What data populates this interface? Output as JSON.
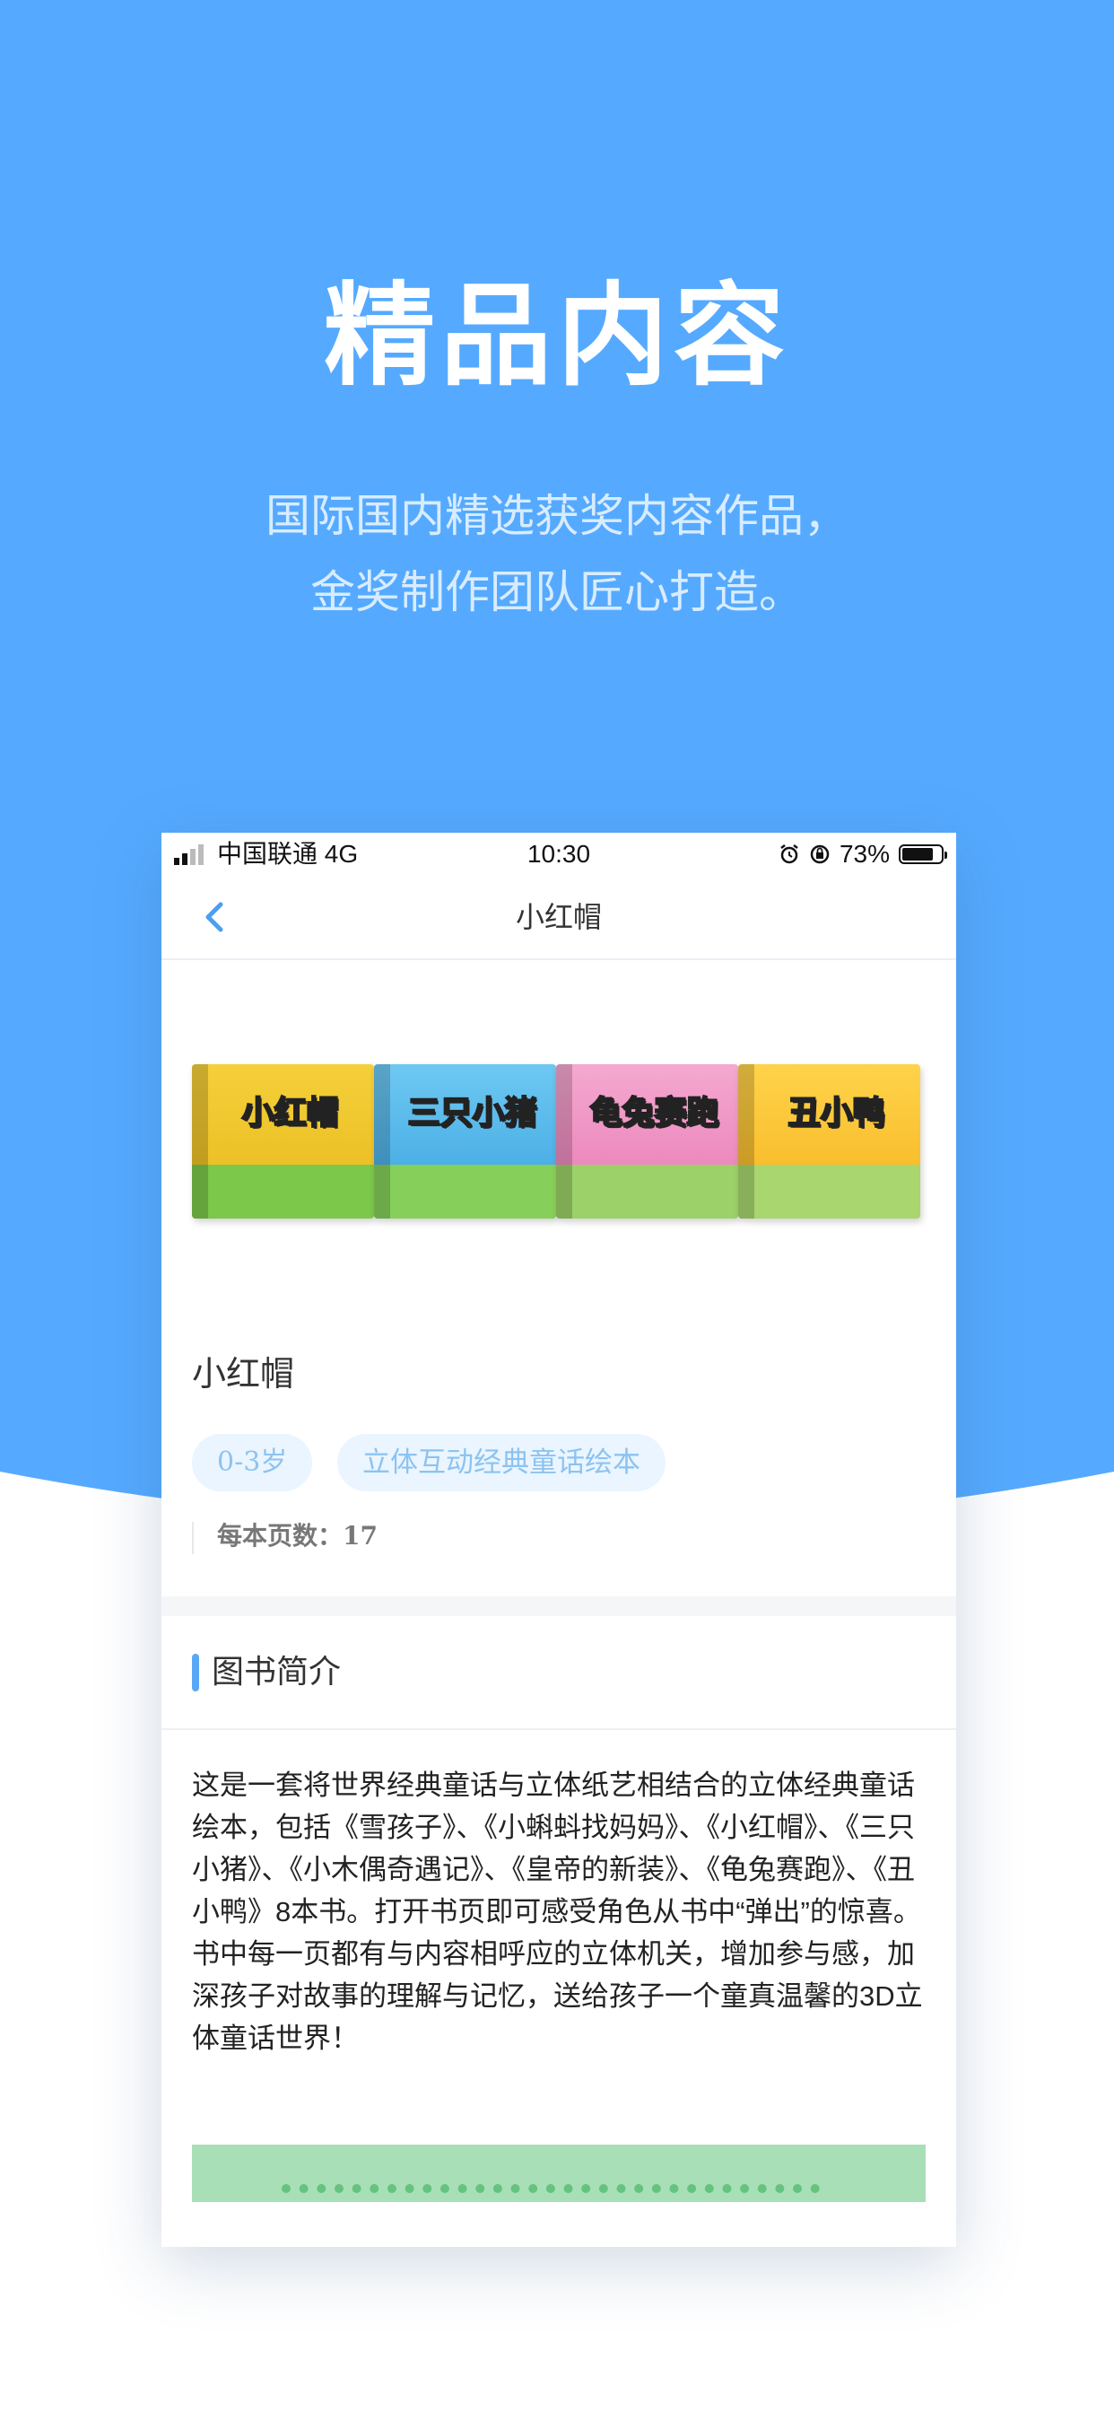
{
  "hero": {
    "title": "精品内容",
    "subtitle_line1": "国际国内精选获奖内容作品，",
    "subtitle_line2": "金奖制作团队匠心打造。"
  },
  "colors": {
    "hero_blue": "#55aaff",
    "accent_blue": "#5aa8f5",
    "tag_bg": "#eaf5ff",
    "tag_text": "#8dc3f0"
  },
  "status_bar": {
    "carrier": "中国联通 4G",
    "time": "10:30",
    "battery_percent": "73%",
    "battery_level": 0.73
  },
  "nav": {
    "title": "小红帽",
    "back_icon": "chevron-left-icon"
  },
  "books": [
    {
      "title": "小红帽"
    },
    {
      "title": "三只小猪"
    },
    {
      "title": "龟兔赛跑"
    },
    {
      "title": "丑小鸭"
    }
  ],
  "detail": {
    "name": "小红帽",
    "tags": [
      "0-3岁",
      "立体互动经典童话绘本"
    ],
    "pages_text": "每本页数：17"
  },
  "intro": {
    "heading": "图书简介",
    "description": "这是一套将世界经典童话与立体纸艺相结合的立体经典童话绘本，包括《雪孩子》、《小蝌蚪找妈妈》、《小红帽》、《三只小猪》、《小木偶奇遇记》、《皇帝的新装》、《龟兔赛跑》、《丑小鸭》8本书。打开书页即可感受角色从书中“弹出”的惊喜。书中每一页都有与内容相呼应的立体机关，增加参与感，加深孩子对故事的理解与记忆，送给孩子一个童真温馨的3D立体童话世界！"
  }
}
